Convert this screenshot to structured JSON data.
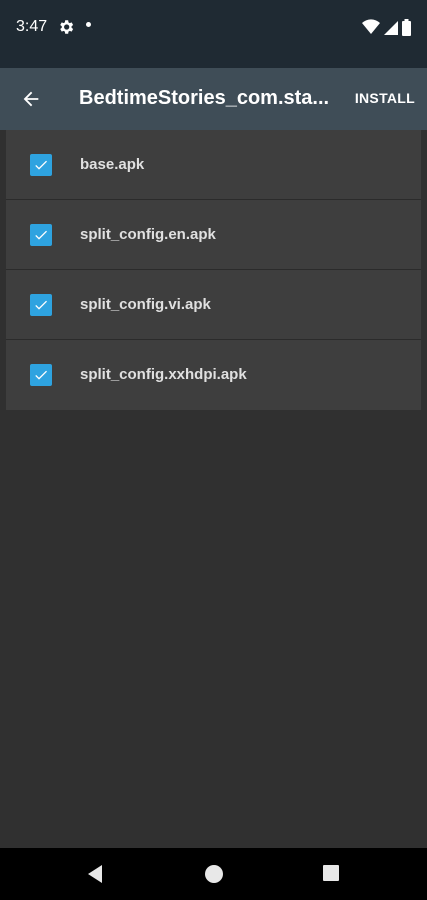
{
  "status_bar": {
    "time": "3:47",
    "icons": [
      "gear-icon",
      "notification-dot-icon",
      "wifi-icon",
      "signal-icon",
      "battery-icon"
    ]
  },
  "toolbar": {
    "title": "BedtimeStories_com.sta...",
    "install_label": "INSTALL",
    "back_icon": "arrow-left-icon"
  },
  "files": [
    {
      "name": "base.apk",
      "checked": true
    },
    {
      "name": "split_config.en.apk",
      "checked": true
    },
    {
      "name": "split_config.vi.apk",
      "checked": true
    },
    {
      "name": "split_config.xxhdpi.apk",
      "checked": true
    }
  ],
  "nav_bar": {
    "icons": [
      "nav-back-icon",
      "nav-home-icon",
      "nav-recents-icon"
    ]
  },
  "colors": {
    "accent": "#2ea3e0",
    "toolbar": "#3f4d57",
    "status_bar": "#1f2a33",
    "background": "#303030",
    "row": "#3e3e3e"
  }
}
